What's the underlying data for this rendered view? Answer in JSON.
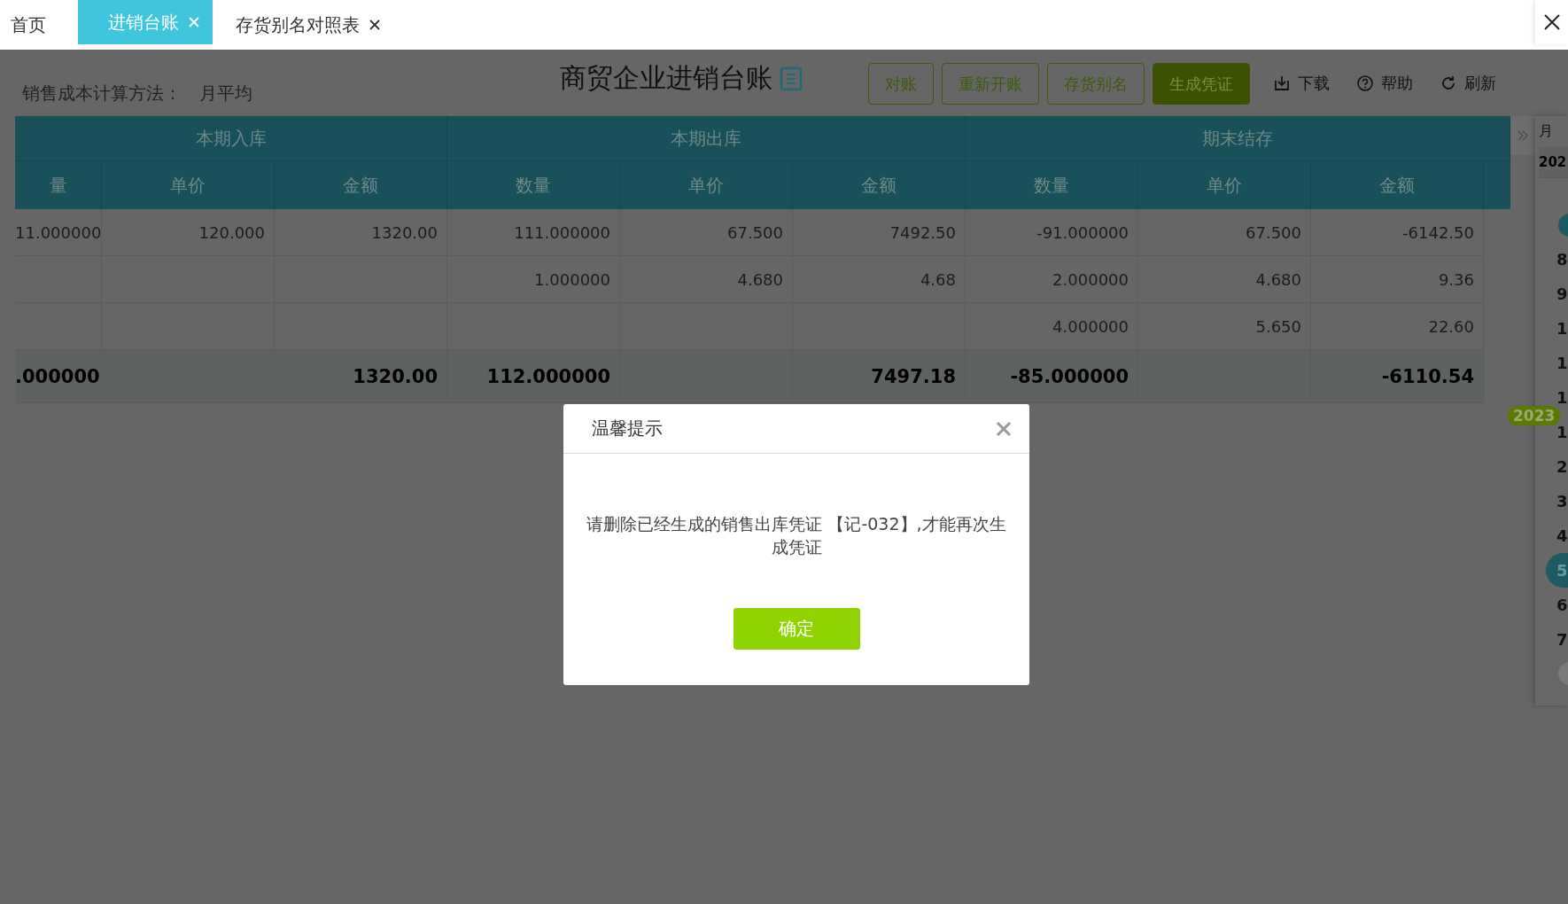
{
  "tabs": [
    {
      "label": "首页",
      "selected": false,
      "closable": false
    },
    {
      "label": "进销台账",
      "selected": true,
      "closable": true
    },
    {
      "label": "存货别名对照表",
      "selected": false,
      "closable": true
    }
  ],
  "toolbar": {
    "method_label": "销售成本计算方法：",
    "method_value": "月平均",
    "title": "商贸企业进销台账",
    "buttons": [
      {
        "label": "对账",
        "kind": "outline"
      },
      {
        "label": "重新开账",
        "kind": "outline"
      },
      {
        "label": "存货别名",
        "kind": "outline"
      },
      {
        "label": "生成凭证",
        "kind": "primary"
      }
    ],
    "actions": [
      {
        "label": "下载",
        "kind": "download"
      },
      {
        "label": "帮助",
        "kind": "help"
      },
      {
        "label": "刷新",
        "kind": "refresh"
      }
    ]
  },
  "table": {
    "groups": [
      {
        "label": "本期入库"
      },
      {
        "label": "本期出库"
      },
      {
        "label": "期末结存"
      }
    ],
    "columns": [
      "量",
      "单价",
      "金额",
      "数量",
      "单价",
      "金额",
      "数量",
      "单价",
      "金额"
    ],
    "rows": [
      {
        "kind": "data",
        "cells": [
          "11.000000",
          "120.000",
          "1320.00",
          "111.000000",
          "67.500",
          "7492.50",
          "-91.000000",
          "67.500",
          "-6142.50"
        ]
      },
      {
        "kind": "data",
        "cells": [
          null,
          null,
          null,
          "1.000000",
          "4.680",
          "4.68",
          "2.000000",
          "4.680",
          "9.36"
        ]
      },
      {
        "kind": "data",
        "cells": [
          null,
          null,
          null,
          null,
          null,
          null,
          "4.000000",
          "5.650",
          "22.60"
        ]
      },
      {
        "kind": "total",
        "cells": [
          ".000000",
          null,
          "1320.00",
          "112.000000",
          null,
          "7497.18",
          "-85.000000",
          null,
          "-6110.54"
        ]
      }
    ]
  },
  "month_panel": {
    "header": "月",
    "year": "202",
    "year_badge": "2023",
    "months": [
      {
        "label": "8",
        "selected": false
      },
      {
        "label": "9",
        "selected": false
      },
      {
        "label": "1",
        "selected": false
      },
      {
        "label": "1",
        "selected": false
      },
      {
        "label": "1",
        "selected": false
      },
      {
        "label": "1",
        "selected": false
      },
      {
        "label": "2",
        "selected": false
      },
      {
        "label": "3",
        "selected": false
      },
      {
        "label": "4",
        "selected": false
      },
      {
        "label": "5",
        "selected": true
      },
      {
        "label": "6",
        "selected": false
      },
      {
        "label": "7",
        "selected": false
      }
    ]
  },
  "dialog": {
    "title": "温馨提示",
    "message": "请删除已经生成的销售出库凭证 【记-032】,才能再次生成凭证",
    "confirm": "确定"
  }
}
